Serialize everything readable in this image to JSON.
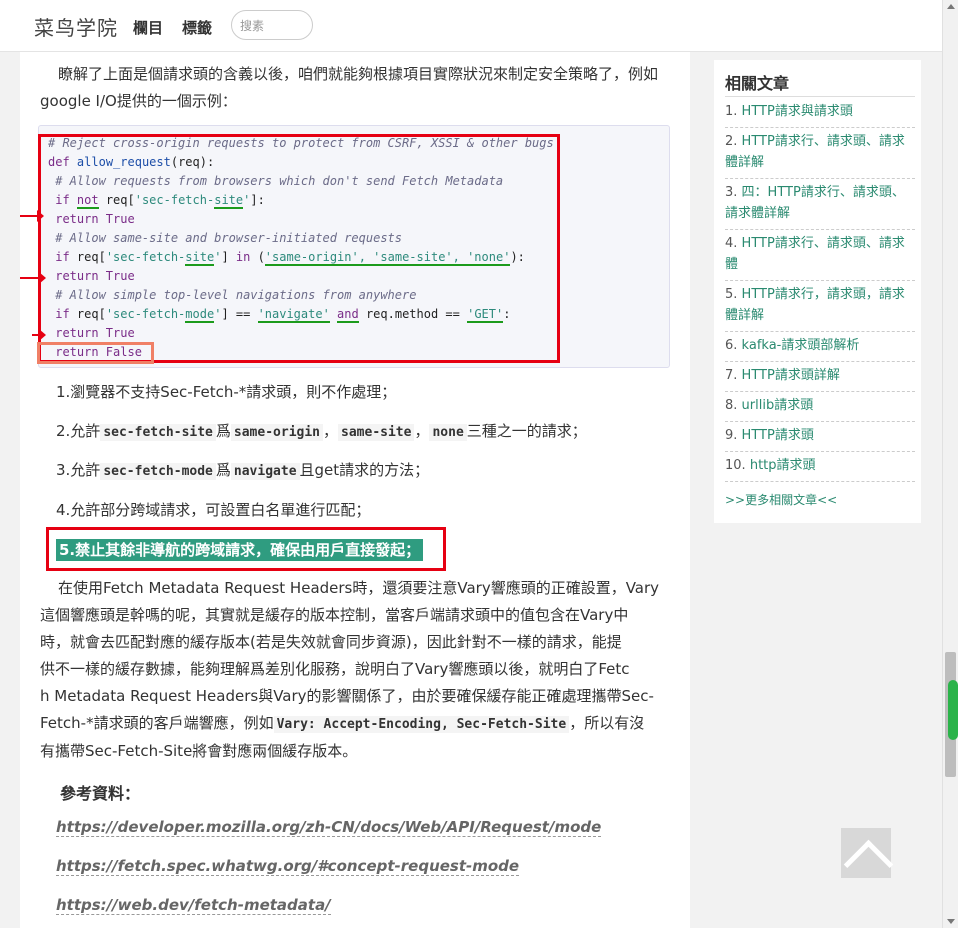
{
  "header": {
    "brand": "菜鸟学院",
    "nav": [
      "欄目",
      "標籤"
    ],
    "search_placeholder": "搜素"
  },
  "article": {
    "intro": "瞭解了上面是個請求頭的含義以後，咱們就能夠根據項目實際狀況來制定安全策略了，例如google I/O提供的一個示例：",
    "code": [
      "# Reject cross-origin requests to protect from CSRF, XSSI & other bugs",
      "def allow_request(req):",
      " # Allow requests from browsers which don't send Fetch Metadata",
      " if not req['sec-fetch-site']:",
      " return True",
      " # Allow same-site and browser-initiated requests",
      " if req['sec-fetch-site'] in ('same-origin', 'same-site', 'none'):",
      " return True",
      " # Allow simple top-level navigations from anywhere",
      " if req['sec-fetch-mode'] == 'navigate' and req.method == 'GET':",
      " return True",
      " return False"
    ],
    "points": {
      "p1": "1.瀏覽器不支持Sec-Fetch-*請求頭，則不作處理；",
      "p2_a": "2.允許",
      "p2_code1": "sec-fetch-site",
      "p2_b": "爲",
      "p2_code2": "same-origin",
      "p2_c": "，",
      "p2_code3": "same-site",
      "p2_d": "，",
      "p2_code4": "none",
      "p2_e": "三種之一的請求；",
      "p3_a": "3.允許",
      "p3_code1": "sec-fetch-mode",
      "p3_b": "爲",
      "p3_code2": "navigate",
      "p3_c": "且get請求的方法；",
      "p4": "4.允許部分跨域請求，可設置白名單進行匹配；",
      "p5": "5.禁止其餘非導航的跨域請求，確保由用戶直接發起；"
    },
    "body_lines": [
      "在使用Fetch Metadata Request Headers時，還須要注意Vary響應頭的正確設置，Vary",
      "這個響應頭是幹嗎的呢，其實就是緩存的版本控制，當客戶端請求頭中的值包含在Vary中",
      "時，就會去匹配對應的緩存版本(若是失效就會同步資源)，因此針對不一樣的請求，能提",
      "供不一樣的緩存數據，能夠理解爲差別化服務，說明白了Vary響應頭以後，就明白了Fetc",
      "h Metadata Request Headers與Vary的影響關係了，由於要確保緩存能正確處理攜帶Sec-"
    ],
    "body_line6_a": "Fetch-*請求頭的客戶端響應，例如",
    "body_line6_code": "Vary: Accept-Encoding, Sec-Fetch-Site",
    "body_line6_b": "，所以有沒",
    "body_line7": "有攜帶Sec-Fetch-Site將會對應兩個緩存版本。",
    "refs_title": "參考資料：",
    "refs": [
      "https://developer.mozilla.org/zh-CN/docs/Web/API/Request/mode",
      "https://fetch.spec.whatwg.org/#concept-request-mode",
      "https://web.dev/fetch-metadata/"
    ]
  },
  "sidebar": {
    "title": "相關文章",
    "items": [
      {
        "num": "1.",
        "text": "HTTP請求與請求頭"
      },
      {
        "num": "2.",
        "text": "HTTP請求行、請求頭、請求體詳解"
      },
      {
        "num": "3.",
        "text": "四：HTTP請求行、請求頭、請求體詳解"
      },
      {
        "num": "4.",
        "text": "HTTP請求行、請求頭、請求體"
      },
      {
        "num": "5.",
        "text": "HTTP請求行，請求頭，請求體詳解"
      },
      {
        "num": "6.",
        "text": "kafka-請求頭部解析"
      },
      {
        "num": "7.",
        "text": "HTTP請求頭詳解"
      },
      {
        "num": "8.",
        "text": "urllib請求頭"
      },
      {
        "num": "9.",
        "text": "HTTP請求頭"
      },
      {
        "num": "10.",
        "text": "http請求頭"
      }
    ],
    "more": ">>更多相關文章<<"
  },
  "colors": {
    "accent_green": "#2a8a70",
    "highlight_bg": "#2f9c80",
    "annotation_red": "#e60012"
  }
}
